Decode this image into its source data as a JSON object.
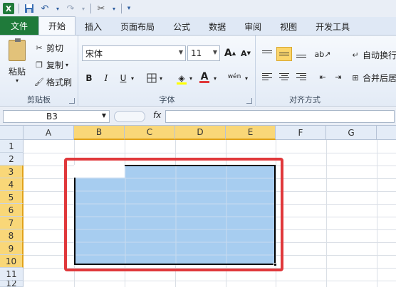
{
  "qat": {
    "logo": "X"
  },
  "tabs": [
    "文件",
    "开始",
    "插入",
    "页面布局",
    "公式",
    "数据",
    "审阅",
    "视图",
    "开发工具"
  ],
  "clipboard": {
    "paste": "粘贴",
    "cut": "剪切",
    "copy": "复制",
    "format_painter": "格式刷",
    "group_label": "剪贴板"
  },
  "font": {
    "name": "宋体",
    "size": "11",
    "grow": "A",
    "shrink": "A",
    "bold": "B",
    "italic": "I",
    "underline": "U",
    "phonetic": "wén",
    "group_label": "字体",
    "fill_color": "#ffff00",
    "font_color": "#e0383b"
  },
  "alignment": {
    "wrap": "自动换行",
    "merge": "合并后居",
    "group_label": "对齐方式"
  },
  "formula_bar": {
    "cell_ref": "B3",
    "fx": "fx",
    "value": ""
  },
  "grid": {
    "columns": [
      "A",
      "B",
      "C",
      "D",
      "E",
      "F",
      "G"
    ],
    "rows": [
      "1",
      "2",
      "3",
      "4",
      "5",
      "6",
      "7",
      "8",
      "9",
      "10",
      "11",
      "12"
    ],
    "selection": "B3:E10",
    "active_cell": "B3"
  },
  "colors": {
    "selection_fill": "#a7cdf0",
    "highlight_border": "#e0383b",
    "header_selected": "#f9d778",
    "file_tab": "#1f7a3a"
  }
}
